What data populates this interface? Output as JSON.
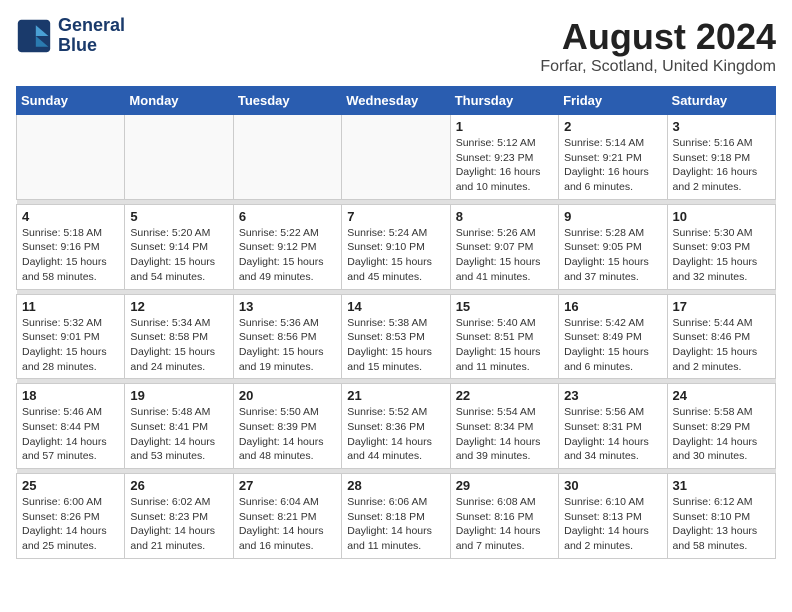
{
  "logo": {
    "line1": "General",
    "line2": "Blue"
  },
  "title": "August 2024",
  "location": "Forfar, Scotland, United Kingdom",
  "weekdays": [
    "Sunday",
    "Monday",
    "Tuesday",
    "Wednesday",
    "Thursday",
    "Friday",
    "Saturday"
  ],
  "weeks": [
    [
      {
        "day": "",
        "info": ""
      },
      {
        "day": "",
        "info": ""
      },
      {
        "day": "",
        "info": ""
      },
      {
        "day": "",
        "info": ""
      },
      {
        "day": "1",
        "info": "Sunrise: 5:12 AM\nSunset: 9:23 PM\nDaylight: 16 hours\nand 10 minutes."
      },
      {
        "day": "2",
        "info": "Sunrise: 5:14 AM\nSunset: 9:21 PM\nDaylight: 16 hours\nand 6 minutes."
      },
      {
        "day": "3",
        "info": "Sunrise: 5:16 AM\nSunset: 9:18 PM\nDaylight: 16 hours\nand 2 minutes."
      }
    ],
    [
      {
        "day": "4",
        "info": "Sunrise: 5:18 AM\nSunset: 9:16 PM\nDaylight: 15 hours\nand 58 minutes."
      },
      {
        "day": "5",
        "info": "Sunrise: 5:20 AM\nSunset: 9:14 PM\nDaylight: 15 hours\nand 54 minutes."
      },
      {
        "day": "6",
        "info": "Sunrise: 5:22 AM\nSunset: 9:12 PM\nDaylight: 15 hours\nand 49 minutes."
      },
      {
        "day": "7",
        "info": "Sunrise: 5:24 AM\nSunset: 9:10 PM\nDaylight: 15 hours\nand 45 minutes."
      },
      {
        "day": "8",
        "info": "Sunrise: 5:26 AM\nSunset: 9:07 PM\nDaylight: 15 hours\nand 41 minutes."
      },
      {
        "day": "9",
        "info": "Sunrise: 5:28 AM\nSunset: 9:05 PM\nDaylight: 15 hours\nand 37 minutes."
      },
      {
        "day": "10",
        "info": "Sunrise: 5:30 AM\nSunset: 9:03 PM\nDaylight: 15 hours\nand 32 minutes."
      }
    ],
    [
      {
        "day": "11",
        "info": "Sunrise: 5:32 AM\nSunset: 9:01 PM\nDaylight: 15 hours\nand 28 minutes."
      },
      {
        "day": "12",
        "info": "Sunrise: 5:34 AM\nSunset: 8:58 PM\nDaylight: 15 hours\nand 24 minutes."
      },
      {
        "day": "13",
        "info": "Sunrise: 5:36 AM\nSunset: 8:56 PM\nDaylight: 15 hours\nand 19 minutes."
      },
      {
        "day": "14",
        "info": "Sunrise: 5:38 AM\nSunset: 8:53 PM\nDaylight: 15 hours\nand 15 minutes."
      },
      {
        "day": "15",
        "info": "Sunrise: 5:40 AM\nSunset: 8:51 PM\nDaylight: 15 hours\nand 11 minutes."
      },
      {
        "day": "16",
        "info": "Sunrise: 5:42 AM\nSunset: 8:49 PM\nDaylight: 15 hours\nand 6 minutes."
      },
      {
        "day": "17",
        "info": "Sunrise: 5:44 AM\nSunset: 8:46 PM\nDaylight: 15 hours\nand 2 minutes."
      }
    ],
    [
      {
        "day": "18",
        "info": "Sunrise: 5:46 AM\nSunset: 8:44 PM\nDaylight: 14 hours\nand 57 minutes."
      },
      {
        "day": "19",
        "info": "Sunrise: 5:48 AM\nSunset: 8:41 PM\nDaylight: 14 hours\nand 53 minutes."
      },
      {
        "day": "20",
        "info": "Sunrise: 5:50 AM\nSunset: 8:39 PM\nDaylight: 14 hours\nand 48 minutes."
      },
      {
        "day": "21",
        "info": "Sunrise: 5:52 AM\nSunset: 8:36 PM\nDaylight: 14 hours\nand 44 minutes."
      },
      {
        "day": "22",
        "info": "Sunrise: 5:54 AM\nSunset: 8:34 PM\nDaylight: 14 hours\nand 39 minutes."
      },
      {
        "day": "23",
        "info": "Sunrise: 5:56 AM\nSunset: 8:31 PM\nDaylight: 14 hours\nand 34 minutes."
      },
      {
        "day": "24",
        "info": "Sunrise: 5:58 AM\nSunset: 8:29 PM\nDaylight: 14 hours\nand 30 minutes."
      }
    ],
    [
      {
        "day": "25",
        "info": "Sunrise: 6:00 AM\nSunset: 8:26 PM\nDaylight: 14 hours\nand 25 minutes."
      },
      {
        "day": "26",
        "info": "Sunrise: 6:02 AM\nSunset: 8:23 PM\nDaylight: 14 hours\nand 21 minutes."
      },
      {
        "day": "27",
        "info": "Sunrise: 6:04 AM\nSunset: 8:21 PM\nDaylight: 14 hours\nand 16 minutes."
      },
      {
        "day": "28",
        "info": "Sunrise: 6:06 AM\nSunset: 8:18 PM\nDaylight: 14 hours\nand 11 minutes."
      },
      {
        "day": "29",
        "info": "Sunrise: 6:08 AM\nSunset: 8:16 PM\nDaylight: 14 hours\nand 7 minutes."
      },
      {
        "day": "30",
        "info": "Sunrise: 6:10 AM\nSunset: 8:13 PM\nDaylight: 14 hours\nand 2 minutes."
      },
      {
        "day": "31",
        "info": "Sunrise: 6:12 AM\nSunset: 8:10 PM\nDaylight: 13 hours\nand 58 minutes."
      }
    ]
  ]
}
